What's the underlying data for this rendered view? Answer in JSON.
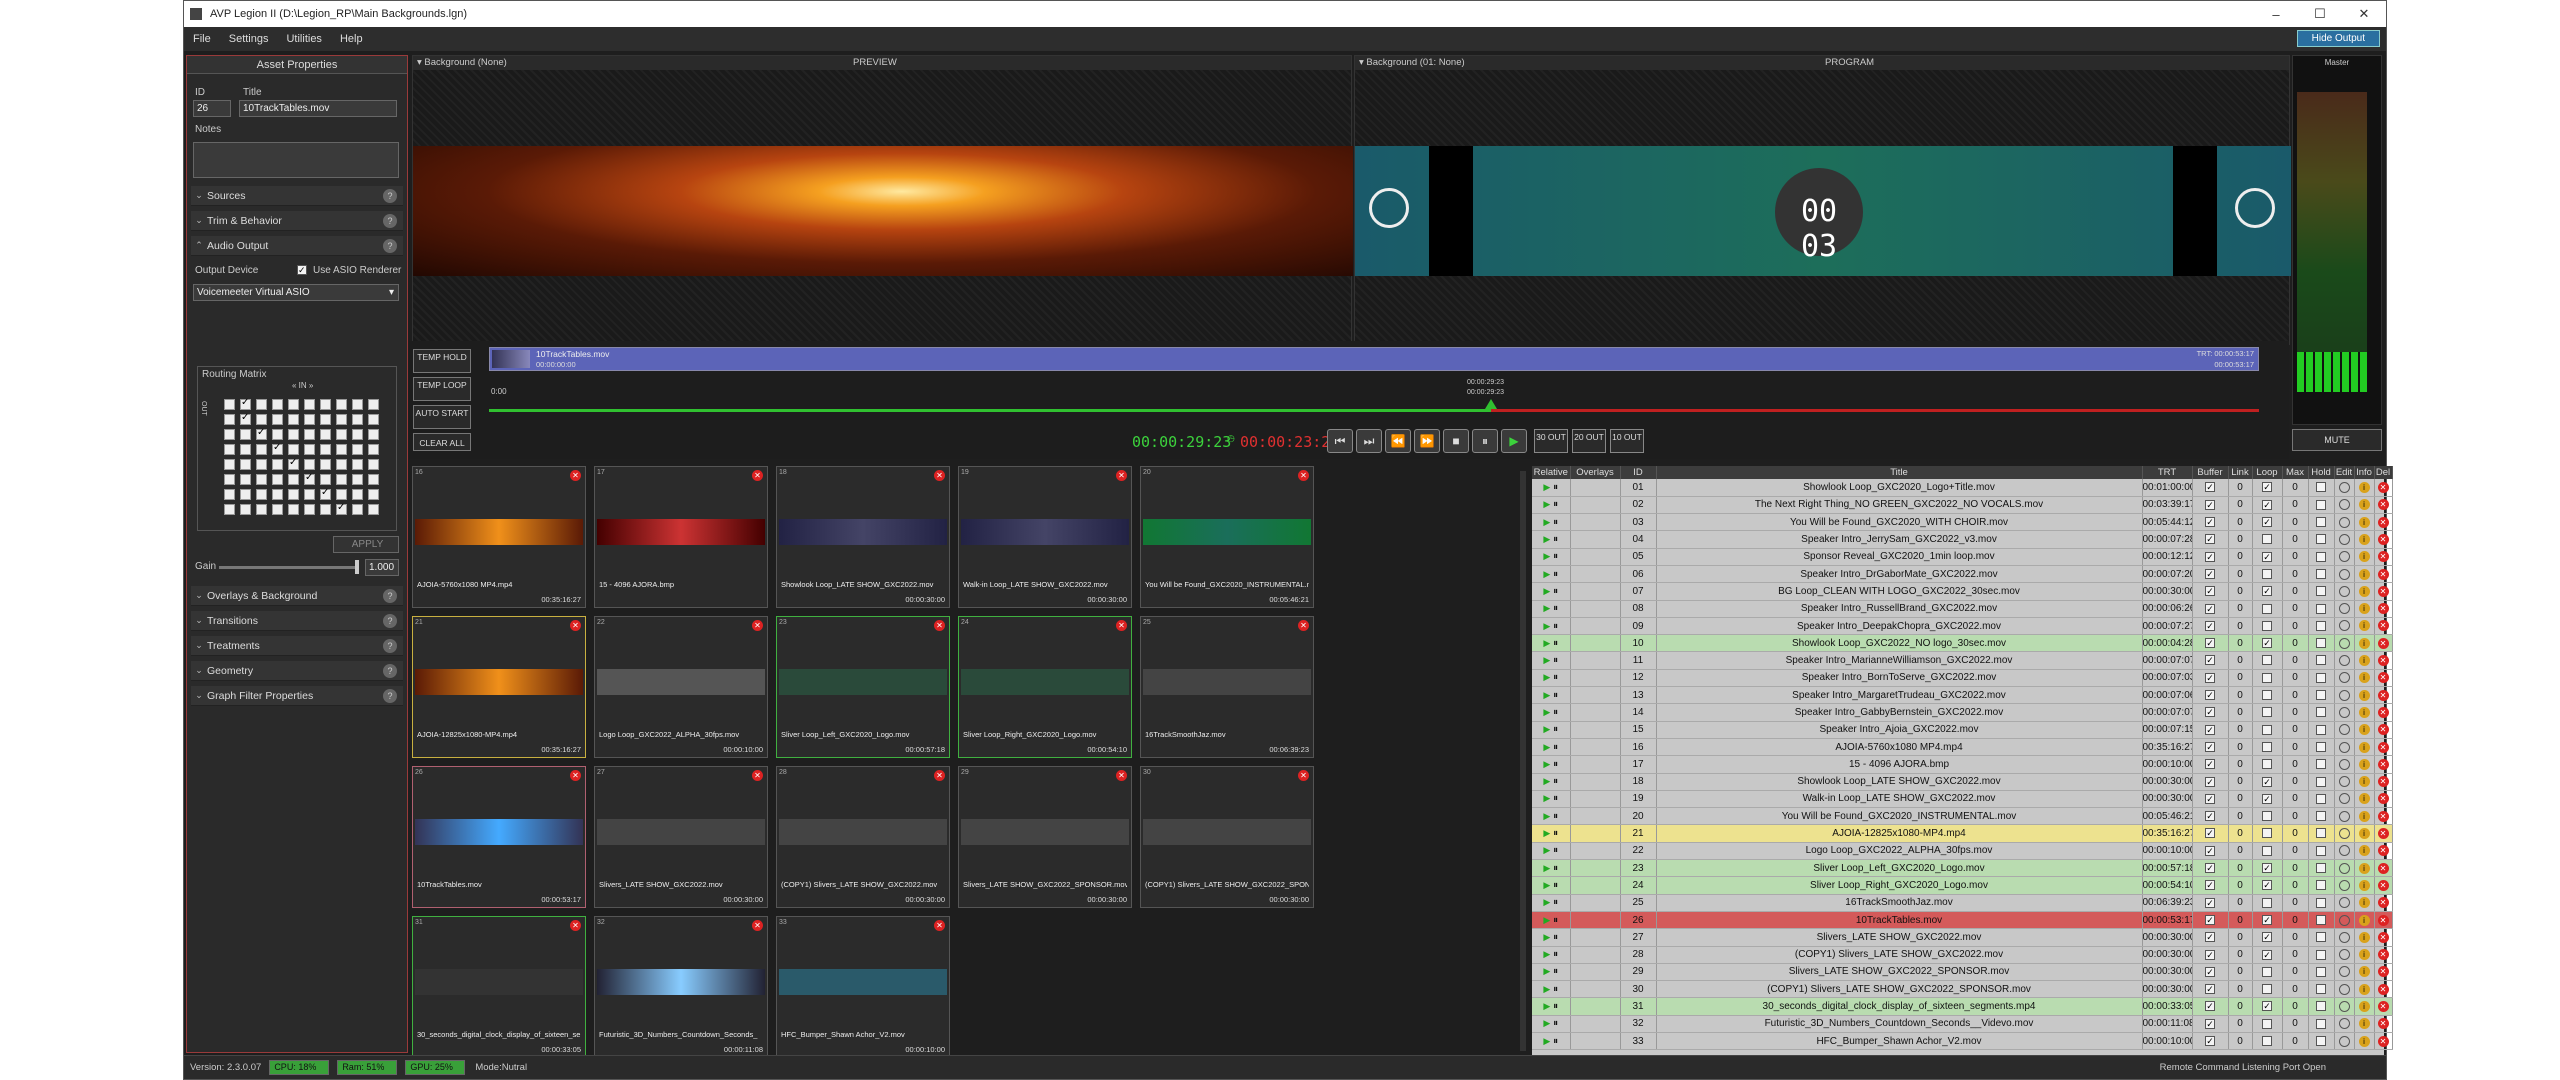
{
  "window": {
    "title": "AVP Legion II (D:\\Legion_RP\\Main Backgrounds.lgn)",
    "min": "–",
    "max": "☐",
    "close": "✕"
  },
  "menu": [
    "File",
    "Settings",
    "Utilities",
    "Help"
  ],
  "hide_output": "Hide Output",
  "asset": {
    "header": "Asset Properties",
    "id_label": "ID",
    "title_label": "Title",
    "id_value": "26",
    "title_value": "10TrackTables.mov",
    "notes_label": "Notes",
    "sections_top": [
      "Sources",
      "Trim & Behavior",
      "Audio Output"
    ],
    "output_device_label": "Output Device",
    "asio_label": "Use ASIO Renderer",
    "device": "Voicemeeter Virtual ASIO",
    "routing_label": "Routing Matrix",
    "in_label": "« IN »",
    "out_label": "OUT",
    "apply": "APPLY",
    "gain_label": "Gain",
    "gain_value": "1.000",
    "sections_bottom": [
      "Overlays & Background",
      "Transitions",
      "Treatments",
      "Geometry",
      "Graph Filter Properties"
    ]
  },
  "preview": {
    "bg_label": "Background (None)",
    "title": "PREVIEW"
  },
  "program": {
    "bg_label": "Background (01: None)",
    "title": "PROGRAM",
    "clock": "00 03"
  },
  "master_label": "Master",
  "mute": "MUTE",
  "timeline": {
    "clip": "10TrackTables.mov",
    "start": "00:00:00:00",
    "trt": "TRT: 00:00:53:17",
    "end": "00:00:53:17",
    "zero": "0:00",
    "cursor_a": "00:00:29:23",
    "cursor_b": "00:00:29:23",
    "temp_hold": "TEMP HOLD",
    "temp_loop": "TEMP LOOP",
    "auto_start": "AUTO START",
    "clear_all": "CLEAR ALL"
  },
  "transport": {
    "elapsed": "00:00:29:23",
    "remain": "00:00:23:23",
    "out30": "30 OUT",
    "out20": "20 OUT",
    "out10": "10 OUT"
  },
  "tiles": [
    {
      "n": "16",
      "name": "AJOIA-5760x1080 MP4.mp4",
      "tc": "00:35:16:27"
    },
    {
      "n": "17",
      "name": "15 - 4096 AJORA.bmp",
      "tc": ""
    },
    {
      "n": "18",
      "name": "Showlook Loop_LATE SHOW_GXC2022.mov",
      "tc": "00:00:30:00"
    },
    {
      "n": "19",
      "name": "Walk-in Loop_LATE SHOW_GXC2022.mov",
      "tc": "00:00:30:00"
    },
    {
      "n": "20",
      "name": "You Will be Found_GXC2020_INSTRUMENTAL.m",
      "tc": "00:05:46:21"
    },
    {
      "n": "21",
      "name": "AJOIA-12825x1080-MP4.mp4",
      "tc": "00:35:16:27"
    },
    {
      "n": "22",
      "name": "Logo Loop_GXC2022_ALPHA_30fps.mov",
      "tc": "00:00:10:00"
    },
    {
      "n": "23",
      "name": "Sliver Loop_Left_GXC2020_Logo.mov",
      "tc": "00:00:57:18"
    },
    {
      "n": "24",
      "name": "Sliver Loop_Right_GXC2020_Logo.mov",
      "tc": "00:00:54:10"
    },
    {
      "n": "25",
      "name": "16TrackSmoothJaz.mov",
      "tc": "00:06:39:23"
    },
    {
      "n": "26",
      "name": "10TrackTables.mov",
      "tc": "00:00:53:17"
    },
    {
      "n": "27",
      "name": "Slivers_LATE SHOW_GXC2022.mov",
      "tc": "00:00:30:00"
    },
    {
      "n": "28",
      "name": "(COPY1) Slivers_LATE SHOW_GXC2022.mov",
      "tc": "00:00:30:00"
    },
    {
      "n": "29",
      "name": "Slivers_LATE SHOW_GXC2022_SPONSOR.mov",
      "tc": "00:00:30:00"
    },
    {
      "n": "30",
      "name": "(COPY1) Slivers_LATE SHOW_GXC2022_SPONSI",
      "tc": "00:00:30:00"
    },
    {
      "n": "31",
      "name": "30_seconds_digital_clock_display_of_sixteen_se",
      "tc": "00:00:33:05"
    },
    {
      "n": "32",
      "name": "Futuristic_3D_Numbers_Countdown_Seconds_",
      "tc": "00:00:11:08"
    },
    {
      "n": "33",
      "name": "HFC_Bumper_Shawn Achor_V2.mov",
      "tc": "00:00:10:00"
    }
  ],
  "playlist": {
    "headers": [
      "Relative",
      "Overlays",
      "ID",
      "Title",
      "TRT",
      "Buffer",
      "Link",
      "Loop",
      "Max",
      "Hold",
      "Edit",
      "Info",
      "Del"
    ],
    "rows": [
      [
        "01",
        "Showlook Loop_GXC2020_Logo+Title.mov",
        "00:01:00:00"
      ],
      [
        "02",
        "The Next Right Thing_NO GREEN_GXC2022_NO VOCALS.mov",
        "00:03:39:17"
      ],
      [
        "03",
        "You Will be Found_GXC2020_WITH CHOIR.mov",
        "00:05:44:12"
      ],
      [
        "04",
        "Speaker Intro_JerrySam_GXC2022_v3.mov",
        "00:00:07:28"
      ],
      [
        "05",
        "Sponsor Reveal_GXC2020_1min loop.mov",
        "00:00:12:12"
      ],
      [
        "06",
        "Speaker Intro_DrGaborMate_GXC2022.mov",
        "00:00:07:20"
      ],
      [
        "07",
        "BG Loop_CLEAN WITH LOGO_GXC2022_30sec.mov",
        "00:00:30:00"
      ],
      [
        "08",
        "Speaker Intro_RussellBrand_GXC2022.mov",
        "00:00:06:26"
      ],
      [
        "09",
        "Speaker Intro_DeepakChopra_GXC2022.mov",
        "00:00:07:27"
      ],
      [
        "10",
        "Showlook Loop_GXC2022_NO logo_30sec.mov",
        "00:00:04:28"
      ],
      [
        "11",
        "Speaker Intro_MarianneWilliamson_GXC2022.mov",
        "00:00:07:07"
      ],
      [
        "12",
        "Speaker Intro_BornToServe_GXC2022.mov",
        "00:00:07:03"
      ],
      [
        "13",
        "Speaker Intro_MargaretTrudeau_GXC2022.mov",
        "00:00:07:06"
      ],
      [
        "14",
        "Speaker Intro_GabbyBernstein_GXC2022.mov",
        "00:00:07:07"
      ],
      [
        "15",
        "Speaker Intro_Ajoia_GXC2022.mov",
        "00:00:07:15"
      ],
      [
        "16",
        "AJOIA-5760x1080 MP4.mp4",
        "00:35:16:27"
      ],
      [
        "17",
        "15 - 4096 AJORA.bmp",
        "00:00:10:00"
      ],
      [
        "18",
        "Showlook Loop_LATE SHOW_GXC2022.mov",
        "00:00:30:00"
      ],
      [
        "19",
        "Walk-in Loop_LATE SHOW_GXC2022.mov",
        "00:00:30:00"
      ],
      [
        "20",
        "You Will be Found_GXC2020_INSTRUMENTAL.mov",
        "00:05:46:21"
      ],
      [
        "21",
        "AJOIA-12825x1080-MP4.mp4",
        "00:35:16:27"
      ],
      [
        "22",
        "Logo Loop_GXC2022_ALPHA_30fps.mov",
        "00:00:10:00"
      ],
      [
        "23",
        "Sliver Loop_Left_GXC2020_Logo.mov",
        "00:00:57:18"
      ],
      [
        "24",
        "Sliver Loop_Right_GXC2020_Logo.mov",
        "00:00:54:10"
      ],
      [
        "25",
        "16TrackSmoothJaz.mov",
        "00:06:39:23"
      ],
      [
        "26",
        "10TrackTables.mov",
        "00:00:53:17"
      ],
      [
        "27",
        "Slivers_LATE SHOW_GXC2022.mov",
        "00:00:30:00"
      ],
      [
        "28",
        "(COPY1) Slivers_LATE SHOW_GXC2022.mov",
        "00:00:30:00"
      ],
      [
        "29",
        "Slivers_LATE SHOW_GXC2022_SPONSOR.mov",
        "00:00:30:00"
      ],
      [
        "30",
        "(COPY1) Slivers_LATE SHOW_GXC2022_SPONSOR.mov",
        "00:00:30:00"
      ],
      [
        "31",
        "30_seconds_digital_clock_display_of_sixteen_segments.mp4",
        "00:00:33:05"
      ],
      [
        "32",
        "Futuristic_3D_Numbers_Countdown_Seconds__Videvo.mov",
        "00:00:11:08"
      ],
      [
        "33",
        "HFC_Bumper_Shawn Achor_V2.mov",
        "00:00:10:00"
      ]
    ]
  },
  "status": {
    "version": "Version: 2.3.0.07",
    "cpu": "CPU: 18%",
    "ram": "Ram: 51%",
    "gpu": "GPU: 25%",
    "mode": "Mode:Nutral",
    "remote": "Remote Command Listening Port Open"
  }
}
